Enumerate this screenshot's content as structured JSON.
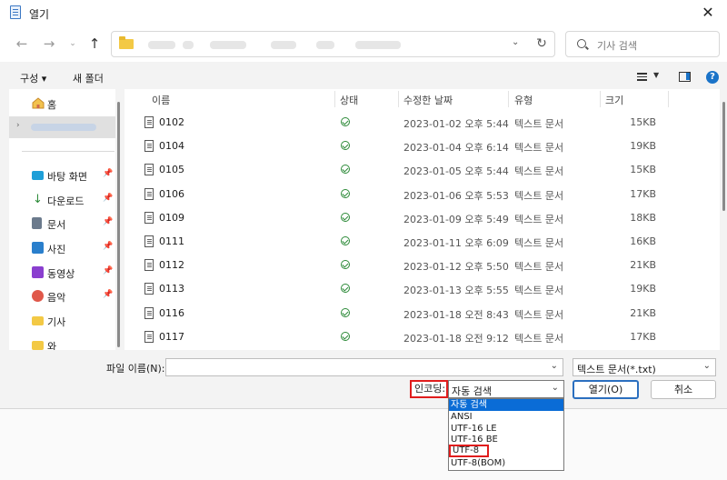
{
  "window": {
    "title": "열기"
  },
  "nav": {
    "search_placeholder": "기사 검색"
  },
  "toolbar": {
    "organize": "구성 ▾",
    "new_folder": "새 폴더"
  },
  "sidebar": {
    "home": "홈",
    "items": [
      {
        "label": "바탕 화면",
        "icon": "desktop-icon",
        "color": "#1e9fd8"
      },
      {
        "label": "다운로드",
        "icon": "download-icon",
        "color": "#2e8b3a"
      },
      {
        "label": "문서",
        "icon": "document-icon",
        "color": "#6b7a8c"
      },
      {
        "label": "사진",
        "icon": "pictures-icon",
        "color": "#2a7fcc"
      },
      {
        "label": "동영상",
        "icon": "video-icon",
        "color": "#8a3fcf"
      },
      {
        "label": "음악",
        "icon": "music-icon",
        "color": "#e0584a"
      },
      {
        "label": "기사",
        "icon": "folder-icon",
        "color": "#f3c945"
      },
      {
        "label": "와",
        "icon": "folder-icon",
        "color": "#f3c945"
      }
    ]
  },
  "columns": {
    "name": "이름",
    "status": "상태",
    "modified": "수정한 날짜",
    "type": "유형",
    "size": "크기"
  },
  "files": [
    {
      "name": "0102",
      "modified": "2023-01-02 오후 5:44",
      "type": "텍스트 문서",
      "size": "15KB"
    },
    {
      "name": "0104",
      "modified": "2023-01-04 오후 6:14",
      "type": "텍스트 문서",
      "size": "19KB"
    },
    {
      "name": "0105",
      "modified": "2023-01-05 오후 5:44",
      "type": "텍스트 문서",
      "size": "15KB"
    },
    {
      "name": "0106",
      "modified": "2023-01-06 오후 5:53",
      "type": "텍스트 문서",
      "size": "17KB"
    },
    {
      "name": "0109",
      "modified": "2023-01-09 오후 5:49",
      "type": "텍스트 문서",
      "size": "18KB"
    },
    {
      "name": "0111",
      "modified": "2023-01-11 오후 6:09",
      "type": "텍스트 문서",
      "size": "16KB"
    },
    {
      "name": "0112",
      "modified": "2023-01-12 오후 5:50",
      "type": "텍스트 문서",
      "size": "21KB"
    },
    {
      "name": "0113",
      "modified": "2023-01-13 오후 5:55",
      "type": "텍스트 문서",
      "size": "19KB"
    },
    {
      "name": "0116",
      "modified": "2023-01-18 오전 8:43",
      "type": "텍스트 문서",
      "size": "21KB"
    },
    {
      "name": "0117",
      "modified": "2023-01-18 오전 9:12",
      "type": "텍스트 문서",
      "size": "17KB"
    }
  ],
  "bottom": {
    "filename_label": "파일 이름(N):",
    "filename_value": "",
    "filetype": "텍스트 문서(*.txt)",
    "encoding_label": "인코딩:",
    "encoding_value": "자동 검색",
    "encoding_options": [
      "자동 검색",
      "ANSI",
      "UTF-16 LE",
      "UTF-16 BE",
      "UTF-8",
      "UTF-8(BOM)"
    ],
    "open_button": "열기(O)",
    "cancel_button": "취소"
  }
}
